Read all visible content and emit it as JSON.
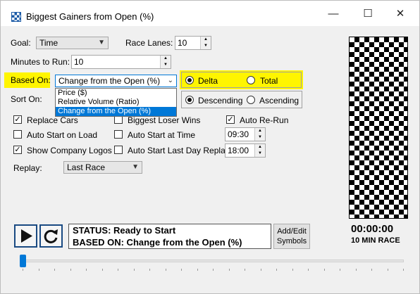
{
  "window": {
    "title": "Biggest Gainers from Open (%)",
    "minimize_glyph": "—",
    "maximize_glyph": "☐",
    "close_glyph": "✕"
  },
  "form": {
    "goal_label": "Goal:",
    "goal_value": "Time",
    "race_lanes_label": "Race Lanes:",
    "race_lanes_value": "10",
    "minutes_label": "Minutes to Run:",
    "minutes_value": "10",
    "based_on_label": "Based On:",
    "based_on_value": "Change from the Open (%)",
    "based_on_options": [
      "Price ($)",
      "Relative Volume (Ratio)",
      "Change from the Open (%)"
    ],
    "delta_label": "Delta",
    "total_label": "Total",
    "delta_selected": true,
    "sort_on_label": "Sort On:",
    "descending_label": "Descending",
    "ascending_label": "Ascending",
    "descending_selected": true,
    "replace_cars_label": "Replace Cars",
    "replace_cars_checked": true,
    "biggest_loser_label": "Biggest Loser Wins",
    "biggest_loser_checked": false,
    "auto_rerun_label": "Auto Re-Run",
    "auto_rerun_checked": true,
    "auto_start_load_label": "Auto Start on Load",
    "auto_start_load_checked": false,
    "auto_start_time_label": "Auto Start at Time",
    "auto_start_time_checked": false,
    "auto_start_time_value": "09:30",
    "show_logos_label": "Show Company Logos",
    "show_logos_checked": true,
    "auto_start_last_label": "Auto Start Last Day Replay",
    "auto_start_last_checked": false,
    "auto_start_last_value": "18:00",
    "replay_label": "Replay:",
    "replay_value": "Last Race"
  },
  "status": {
    "line1": "STATUS: Ready to Start",
    "line2": "BASED ON: Change from the Open (%)"
  },
  "add_edit_label_1": "Add/Edit",
  "add_edit_label_2": "Symbols",
  "timer": "00:00:00",
  "race_length": "10 MIN RACE",
  "slider_value": 0,
  "colors": {
    "highlight": "#fff500",
    "selection": "#0078d7",
    "accent": "#1a4a82"
  }
}
